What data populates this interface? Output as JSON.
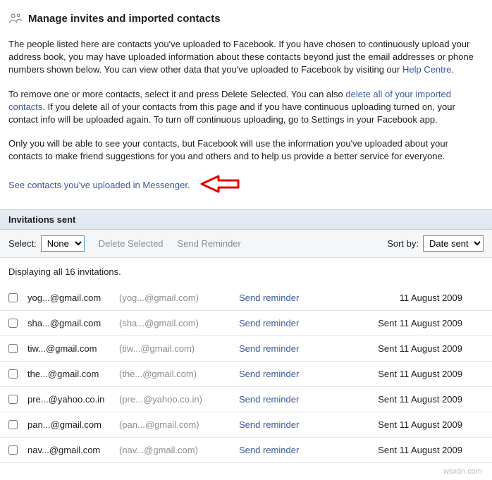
{
  "header": {
    "title": "Manage invites and imported contacts"
  },
  "intro": {
    "p1a": "The people listed here are contacts you've uploaded to Facebook. If you have chosen to continuously upload your address book, you may have uploaded information about these contacts beyond just the email addresses or phone numbers shown below. You can view other data that you've uploaded to Facebook by visiting our ",
    "help_link": "Help Centre",
    "p1b": ".",
    "p2a": "To remove one or more contacts, select it and press Delete Selected. You can also ",
    "delete_link": "delete all of your imported contacts",
    "p2b": ". If you delete all of your contacts from this page and if you have continuous uploading turned on, your contact info will be uploaded again. To turn off continuous uploading, go to Settings in your Facebook app.",
    "p3": "Only you will be able to see your contacts, but Facebook will use the information you've uploaded about your contacts to make friend suggestions for you and others and to help us provide a better service for everyone.",
    "msg_link": "See contacts you've uploaded in Messenger."
  },
  "section": {
    "banner": "Invitations sent"
  },
  "toolbar": {
    "select_label": "Select:",
    "select_value": "None",
    "delete_btn": "Delete Selected",
    "reminder_btn": "Send Reminder",
    "sort_label": "Sort by:",
    "sort_value": "Date sent"
  },
  "count_label": "Displaying all 16 invitations.",
  "action_label": "Send reminder",
  "rows": [
    {
      "email": "yog...@gmail.com",
      "email2": "(yog...@gmail.com)",
      "date": "11 August 2009"
    },
    {
      "email": "sha...@gmail.com",
      "email2": "(sha...@gmail.com)",
      "date": "Sent 11 August 2009"
    },
    {
      "email": "tiw...@gmail.com",
      "email2": "(tiw...@gmail.com)",
      "date": "Sent 11 August 2009"
    },
    {
      "email": "the...@gmail.com",
      "email2": "(the...@gmail.com)",
      "date": "Sent 11 August 2009"
    },
    {
      "email": "pre...@yahoo.co.in",
      "email2": "(pre...@yahoo.co.in)",
      "date": "Sent 11 August 2009"
    },
    {
      "email": "pan...@gmail.com",
      "email2": "(pan...@gmail.com)",
      "date": "Sent 11 August 2009"
    },
    {
      "email": "nav...@gmail.com",
      "email2": "(nav...@gmail.com)",
      "date": "Sent 11 August 2009"
    }
  ],
  "watermark": "wsxdn.com"
}
